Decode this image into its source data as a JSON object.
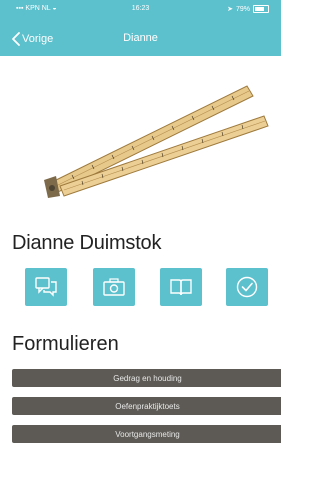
{
  "status": {
    "carrier": "KPN NL",
    "time": "16:23",
    "battery": "79%",
    "battery_level": 0.79
  },
  "nav": {
    "back_label": "Vorige",
    "title": "Dianne"
  },
  "profile": {
    "name": "Dianne Duimstok"
  },
  "actions": [
    {
      "icon": "chat-icon"
    },
    {
      "icon": "camera-icon"
    },
    {
      "icon": "book-icon"
    },
    {
      "icon": "checkmark-icon"
    }
  ],
  "forms": {
    "title": "Formulieren",
    "items": [
      "Gedrag en houding",
      "Oefenpraktijktoets",
      "Voortgangsmeting"
    ]
  },
  "colors": {
    "accent": "#5cc0cd",
    "form_button": "#5d5a55"
  }
}
